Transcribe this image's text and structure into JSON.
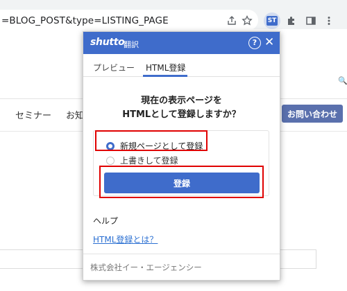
{
  "browser": {
    "url_fragment": "=BLOG_POST&type=LISTING_PAGE",
    "ext_label": "ST"
  },
  "background_page": {
    "nav": [
      "セミナー",
      "お知"
    ],
    "contact_button": "お問い合わせ",
    "search_glyph": "🔍"
  },
  "popup": {
    "logo": "shutto",
    "logo_sub": "翻訳",
    "help_glyph": "?",
    "close_glyph": "✕",
    "tabs": [
      {
        "label": "プレビュー"
      },
      {
        "label": "HTML登録"
      }
    ],
    "question_line1": "現在の表示ページを",
    "question_line2": "HTMLとして登録しますか？",
    "options": [
      {
        "label": "新規ページとして登録",
        "selected": true
      },
      {
        "label": "上書きして登録",
        "selected": false
      }
    ],
    "submit_label": "登録",
    "help_title": "ヘルプ",
    "help_link": "HTML登録とは？",
    "footer": "株式会社イー・エージェンシー"
  },
  "colors": {
    "accent": "#3f6ccb",
    "highlight": "#e00000",
    "contact_button": "#5a70ad"
  }
}
